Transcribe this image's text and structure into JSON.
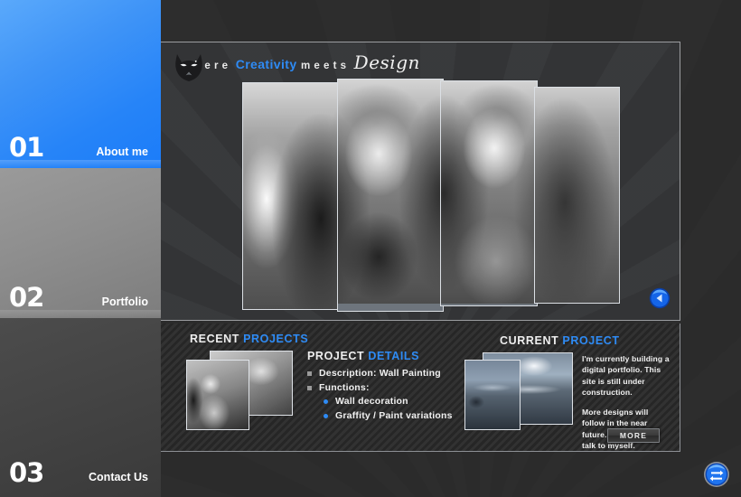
{
  "sidebar": {
    "items": [
      {
        "number": "01",
        "label": "About me",
        "color": "#2684f8"
      },
      {
        "number": "02",
        "label": "Portfolio",
        "color": "#8e8e8e"
      },
      {
        "number": "03",
        "label": "Contact Us",
        "color": "#444444"
      }
    ]
  },
  "tagline": {
    "word1": "where",
    "word2": "Creativity",
    "word3": "meets",
    "word4": "Design"
  },
  "slideshow": {
    "logo_icon": "fox-head-logo-icon",
    "next_icon": "next-arrow-orb-icon",
    "panes": 4
  },
  "recent": {
    "heading_a": "RECENT",
    "heading_b": "PROJECTS"
  },
  "details": {
    "heading_a": "PROJECT",
    "heading_b": "DETAILS",
    "rows": [
      {
        "type": "square",
        "text": "Description:  Wall Painting"
      },
      {
        "type": "square",
        "text": "Functions:"
      },
      {
        "type": "dot",
        "text": "Wall decoration"
      },
      {
        "type": "dot",
        "text": "Graffity / Paint variations"
      }
    ]
  },
  "current": {
    "heading_a": "CURRENT",
    "heading_b": "PROJECT",
    "paragraph1": "I'm currently building a digital portfolio. This site is still under construction.",
    "paragraph2": "More designs will follow in the near future. Untill then I'll talk to myself.",
    "more_label": "MORE"
  },
  "footer": {
    "orb_icon": "swap-arrows-orb-icon"
  },
  "colors": {
    "accent_blue": "#2e8bf5",
    "panel_dark": "#2b2b2b",
    "border_light": "#9b9da0"
  }
}
